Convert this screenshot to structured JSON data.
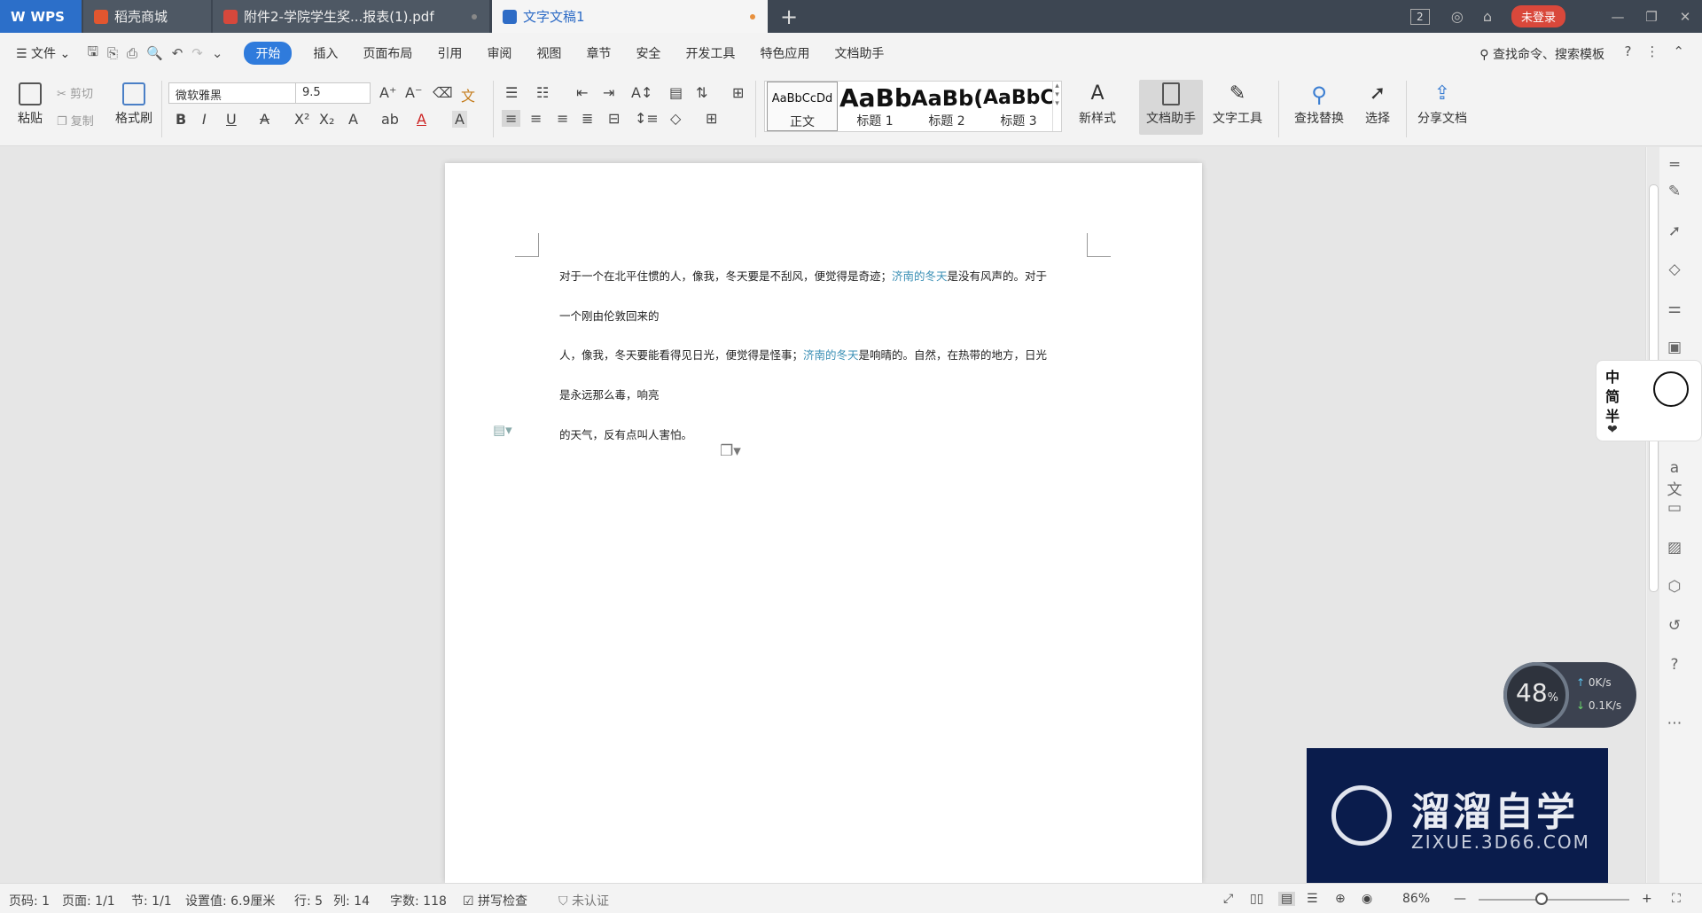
{
  "titlebar": {
    "tabs": [
      {
        "label": "WPS"
      },
      {
        "label": "稻壳商城"
      },
      {
        "label": "附件2-学院学生奖...报表(1).pdf"
      },
      {
        "label": "文字文稿1"
      }
    ],
    "badge": "2",
    "login": "未登录"
  },
  "menubar": {
    "file": "文件",
    "items": [
      "开始",
      "插入",
      "页面布局",
      "引用",
      "审阅",
      "视图",
      "章节",
      "安全",
      "开发工具",
      "特色应用",
      "文档助手"
    ],
    "search": "查找命令、搜索模板"
  },
  "ribbon": {
    "paste": "粘贴",
    "cut": "剪切",
    "copy": "复制",
    "format_painter": "格式刷",
    "font": "微软雅黑",
    "size": "9.5",
    "styles": [
      {
        "preview": "AaBbCcDd",
        "label": "正文"
      },
      {
        "preview": "AaBb",
        "label": "标题 1"
      },
      {
        "preview": "AaBb(",
        "label": "标题 2"
      },
      {
        "preview": "AaBbC",
        "label": "标题 3"
      }
    ],
    "new_style": "新样式",
    "doc_assistant": "文档助手",
    "text_tools": "文字工具",
    "find_replace": "查找替换",
    "select": "选择",
    "share": "分享文档"
  },
  "document": {
    "lines": [
      {
        "a": "对于一个在北平住惯的人，像我，冬天要是不刮风，便觉得是奇迹；",
        "link": "济南的冬天",
        "b": "是没有风声的。对于"
      },
      {
        "a": "一个刚由伦敦回来的",
        "link": "",
        "b": ""
      },
      {
        "a": "人，像我，冬天要能看得见日光，便觉得是怪事；",
        "link": "济南的冬天",
        "b": "是响晴的。自然，在热带的地方，日光"
      },
      {
        "a": "是永远那么毒，响亮",
        "link": "",
        "b": ""
      },
      {
        "a": "的天气，反有点叫人害怕。",
        "link": "",
        "b": ""
      }
    ]
  },
  "statusbar": {
    "page_no": "页码: 1",
    "pages": "页面: 1/1",
    "section": "节: 1/1",
    "setting": "设置值: 6.9厘米",
    "row": "行: 5",
    "col": "列: 14",
    "words": "字数: 118",
    "spell": "拼写检查",
    "cert": "未认证",
    "zoom": "86%"
  },
  "overlay": {
    "gauge_pct": "48",
    "up": "0K/s",
    "down": "0.1K/s",
    "sticker": "中简半",
    "watermark_title": "溜溜自学",
    "watermark_sub": "ZIXUE.3D66.COM"
  }
}
